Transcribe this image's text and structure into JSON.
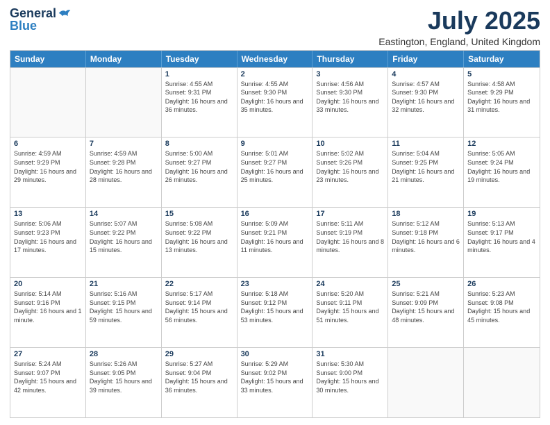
{
  "logo": {
    "general": "General",
    "blue": "Blue"
  },
  "title": "July 2025",
  "subtitle": "Eastington, England, United Kingdom",
  "days_of_week": [
    "Sunday",
    "Monday",
    "Tuesday",
    "Wednesday",
    "Thursday",
    "Friday",
    "Saturday"
  ],
  "weeks": [
    [
      {
        "day": "",
        "empty": true
      },
      {
        "day": "",
        "empty": true
      },
      {
        "day": "1",
        "sunrise": "Sunrise: 4:55 AM",
        "sunset": "Sunset: 9:31 PM",
        "daylight": "Daylight: 16 hours and 36 minutes."
      },
      {
        "day": "2",
        "sunrise": "Sunrise: 4:55 AM",
        "sunset": "Sunset: 9:30 PM",
        "daylight": "Daylight: 16 hours and 35 minutes."
      },
      {
        "day": "3",
        "sunrise": "Sunrise: 4:56 AM",
        "sunset": "Sunset: 9:30 PM",
        "daylight": "Daylight: 16 hours and 33 minutes."
      },
      {
        "day": "4",
        "sunrise": "Sunrise: 4:57 AM",
        "sunset": "Sunset: 9:30 PM",
        "daylight": "Daylight: 16 hours and 32 minutes."
      },
      {
        "day": "5",
        "sunrise": "Sunrise: 4:58 AM",
        "sunset": "Sunset: 9:29 PM",
        "daylight": "Daylight: 16 hours and 31 minutes."
      }
    ],
    [
      {
        "day": "6",
        "sunrise": "Sunrise: 4:59 AM",
        "sunset": "Sunset: 9:29 PM",
        "daylight": "Daylight: 16 hours and 29 minutes."
      },
      {
        "day": "7",
        "sunrise": "Sunrise: 4:59 AM",
        "sunset": "Sunset: 9:28 PM",
        "daylight": "Daylight: 16 hours and 28 minutes."
      },
      {
        "day": "8",
        "sunrise": "Sunrise: 5:00 AM",
        "sunset": "Sunset: 9:27 PM",
        "daylight": "Daylight: 16 hours and 26 minutes."
      },
      {
        "day": "9",
        "sunrise": "Sunrise: 5:01 AM",
        "sunset": "Sunset: 9:27 PM",
        "daylight": "Daylight: 16 hours and 25 minutes."
      },
      {
        "day": "10",
        "sunrise": "Sunrise: 5:02 AM",
        "sunset": "Sunset: 9:26 PM",
        "daylight": "Daylight: 16 hours and 23 minutes."
      },
      {
        "day": "11",
        "sunrise": "Sunrise: 5:04 AM",
        "sunset": "Sunset: 9:25 PM",
        "daylight": "Daylight: 16 hours and 21 minutes."
      },
      {
        "day": "12",
        "sunrise": "Sunrise: 5:05 AM",
        "sunset": "Sunset: 9:24 PM",
        "daylight": "Daylight: 16 hours and 19 minutes."
      }
    ],
    [
      {
        "day": "13",
        "sunrise": "Sunrise: 5:06 AM",
        "sunset": "Sunset: 9:23 PM",
        "daylight": "Daylight: 16 hours and 17 minutes."
      },
      {
        "day": "14",
        "sunrise": "Sunrise: 5:07 AM",
        "sunset": "Sunset: 9:22 PM",
        "daylight": "Daylight: 16 hours and 15 minutes."
      },
      {
        "day": "15",
        "sunrise": "Sunrise: 5:08 AM",
        "sunset": "Sunset: 9:22 PM",
        "daylight": "Daylight: 16 hours and 13 minutes."
      },
      {
        "day": "16",
        "sunrise": "Sunrise: 5:09 AM",
        "sunset": "Sunset: 9:21 PM",
        "daylight": "Daylight: 16 hours and 11 minutes."
      },
      {
        "day": "17",
        "sunrise": "Sunrise: 5:11 AM",
        "sunset": "Sunset: 9:19 PM",
        "daylight": "Daylight: 16 hours and 8 minutes."
      },
      {
        "day": "18",
        "sunrise": "Sunrise: 5:12 AM",
        "sunset": "Sunset: 9:18 PM",
        "daylight": "Daylight: 16 hours and 6 minutes."
      },
      {
        "day": "19",
        "sunrise": "Sunrise: 5:13 AM",
        "sunset": "Sunset: 9:17 PM",
        "daylight": "Daylight: 16 hours and 4 minutes."
      }
    ],
    [
      {
        "day": "20",
        "sunrise": "Sunrise: 5:14 AM",
        "sunset": "Sunset: 9:16 PM",
        "daylight": "Daylight: 16 hours and 1 minute."
      },
      {
        "day": "21",
        "sunrise": "Sunrise: 5:16 AM",
        "sunset": "Sunset: 9:15 PM",
        "daylight": "Daylight: 15 hours and 59 minutes."
      },
      {
        "day": "22",
        "sunrise": "Sunrise: 5:17 AM",
        "sunset": "Sunset: 9:14 PM",
        "daylight": "Daylight: 15 hours and 56 minutes."
      },
      {
        "day": "23",
        "sunrise": "Sunrise: 5:18 AM",
        "sunset": "Sunset: 9:12 PM",
        "daylight": "Daylight: 15 hours and 53 minutes."
      },
      {
        "day": "24",
        "sunrise": "Sunrise: 5:20 AM",
        "sunset": "Sunset: 9:11 PM",
        "daylight": "Daylight: 15 hours and 51 minutes."
      },
      {
        "day": "25",
        "sunrise": "Sunrise: 5:21 AM",
        "sunset": "Sunset: 9:09 PM",
        "daylight": "Daylight: 15 hours and 48 minutes."
      },
      {
        "day": "26",
        "sunrise": "Sunrise: 5:23 AM",
        "sunset": "Sunset: 9:08 PM",
        "daylight": "Daylight: 15 hours and 45 minutes."
      }
    ],
    [
      {
        "day": "27",
        "sunrise": "Sunrise: 5:24 AM",
        "sunset": "Sunset: 9:07 PM",
        "daylight": "Daylight: 15 hours and 42 minutes."
      },
      {
        "day": "28",
        "sunrise": "Sunrise: 5:26 AM",
        "sunset": "Sunset: 9:05 PM",
        "daylight": "Daylight: 15 hours and 39 minutes."
      },
      {
        "day": "29",
        "sunrise": "Sunrise: 5:27 AM",
        "sunset": "Sunset: 9:04 PM",
        "daylight": "Daylight: 15 hours and 36 minutes."
      },
      {
        "day": "30",
        "sunrise": "Sunrise: 5:29 AM",
        "sunset": "Sunset: 9:02 PM",
        "daylight": "Daylight: 15 hours and 33 minutes."
      },
      {
        "day": "31",
        "sunrise": "Sunrise: 5:30 AM",
        "sunset": "Sunset: 9:00 PM",
        "daylight": "Daylight: 15 hours and 30 minutes."
      },
      {
        "day": "",
        "empty": true
      },
      {
        "day": "",
        "empty": true
      }
    ]
  ]
}
